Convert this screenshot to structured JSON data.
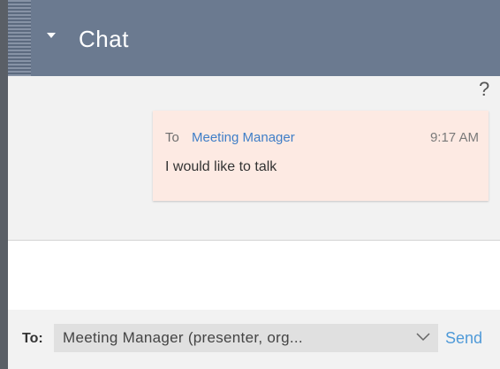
{
  "header": {
    "title": "Chat",
    "collapse_icon": "caret-down-icon"
  },
  "chat": {
    "help_label": "?",
    "messages": [
      {
        "to_prefix": "To",
        "recipient": "Meeting Manager",
        "time": "9:17 AM",
        "text": "I would like to talk"
      }
    ]
  },
  "footer": {
    "to_label": "To:",
    "recipient_selected": "Meeting  Manager  (presenter, org...",
    "send_label": "Send"
  },
  "colors": {
    "header_bg": "#6b7a90",
    "message_bg": "#fdeae3",
    "link_blue": "#3f7ec7",
    "send_blue": "#4f9ad8"
  }
}
